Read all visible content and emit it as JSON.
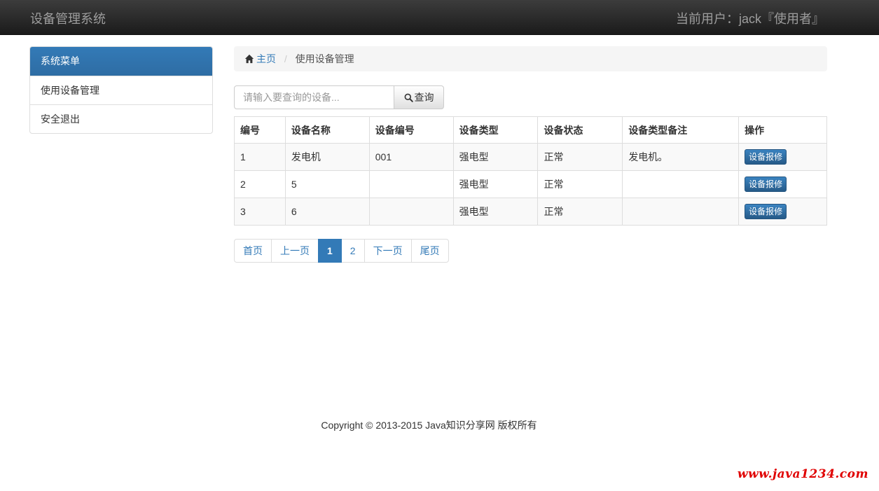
{
  "header": {
    "brand": "设备管理系统",
    "user_label": "当前用户：",
    "user_name": "jack",
    "user_role": "『使用者』"
  },
  "sidebar": {
    "title": "系统菜单",
    "items": [
      {
        "label": "使用设备管理"
      },
      {
        "label": "安全退出"
      }
    ]
  },
  "breadcrumb": {
    "home": "主页",
    "current": "使用设备管理",
    "separator": "/"
  },
  "search": {
    "placeholder": "请输入要查询的设备...",
    "value": "",
    "button_label": "查询"
  },
  "table": {
    "headers": [
      "编号",
      "设备名称",
      "设备编号",
      "设备类型",
      "设备状态",
      "设备类型备注",
      "操作"
    ],
    "rows": [
      {
        "id": "1",
        "name": "发电机",
        "code": "001",
        "type": "强电型",
        "status": "正常",
        "remark": "发电机。",
        "action": "设备报修"
      },
      {
        "id": "2",
        "name": "5",
        "code": "",
        "type": "强电型",
        "status": "正常",
        "remark": "",
        "action": "设备报修"
      },
      {
        "id": "3",
        "name": "6",
        "code": "",
        "type": "强电型",
        "status": "正常",
        "remark": "",
        "action": "设备报修"
      }
    ]
  },
  "pagination": {
    "first": "首页",
    "prev": "上一页",
    "pages": [
      "1",
      "2"
    ],
    "current": "1",
    "next": "下一页",
    "last": "尾页"
  },
  "footer": {
    "copyright": "Copyright © 2013-2015 Java知识分享网 版权所有"
  },
  "watermark": "www.java1234.com",
  "colors": {
    "accent": "#337ab7",
    "navbar": "#222222",
    "watermark": "#e00000"
  },
  "icons": {
    "home": "home-icon",
    "search": "search-icon"
  }
}
